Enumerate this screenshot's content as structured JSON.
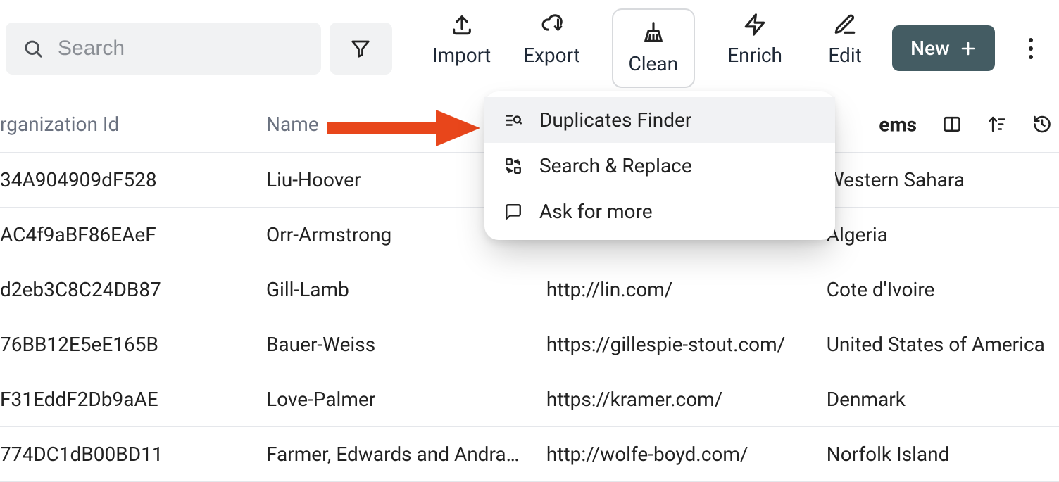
{
  "search": {
    "placeholder": "Search"
  },
  "toolbar": {
    "import": "Import",
    "export": "Export",
    "clean": "Clean",
    "enrich": "Enrich",
    "edit": "Edit",
    "new": "New"
  },
  "dropdown": {
    "duplicates": "Duplicates Finder",
    "replace": "Search & Replace",
    "ask": "Ask for more"
  },
  "columns": {
    "org": "rganization Id",
    "name": "Name",
    "items": "ems"
  },
  "rows": [
    {
      "org": "34A904909dF528",
      "name": "Liu-Hoover",
      "url": "",
      "country": "Western Sahara"
    },
    {
      "org": "AC4f9aBF86EAeF",
      "name": "Orr-Armstrong",
      "url": "",
      "country": "Algeria"
    },
    {
      "org": "d2eb3C8C24DB87",
      "name": "Gill-Lamb",
      "url": "http://lin.com/",
      "country": "Cote d'Ivoire"
    },
    {
      "org": "76BB12E5eE165B",
      "name": "Bauer-Weiss",
      "url": "https://gillespie-stout.com/",
      "country": "United States of America"
    },
    {
      "org": "F31EddF2Db9aAE",
      "name": "Love-Palmer",
      "url": "https://kramer.com/",
      "country": "Denmark"
    },
    {
      "org": "774DC1dB00BD11",
      "name": "Farmer, Edwards and Andra…",
      "url": "http://wolfe-boyd.com/",
      "country": "Norfolk Island"
    }
  ]
}
